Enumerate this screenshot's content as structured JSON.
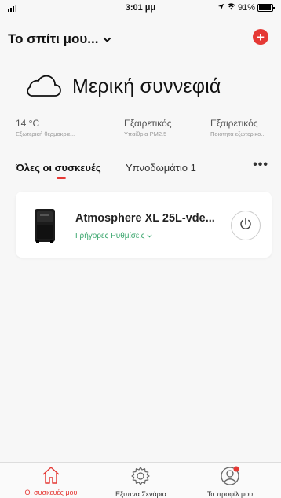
{
  "status_bar": {
    "time": "3:01 μμ",
    "battery": "91%",
    "battery_fraction": 0.91
  },
  "header": {
    "home_name": "Το σπίτι μου...",
    "add_icon": "plus-circle-icon"
  },
  "weather": {
    "icon": "cloud-icon",
    "condition": "Μερική συννεφιά"
  },
  "stats": [
    {
      "value": "14 °C",
      "label": "Εξωτερική θερμοκρα..."
    },
    {
      "value": "Εξαιρετικός",
      "label": "Υπαίθρια PM2.5"
    },
    {
      "value": "Εξαιρετικός",
      "label": "Ποιότητα εξωτερικο..."
    }
  ],
  "tabs": [
    {
      "label": "Όλες οι συσκευές",
      "active": true
    },
    {
      "label": "Υπνοδωμάτιο 1",
      "active": false
    }
  ],
  "more_label": "•••",
  "devices": [
    {
      "name": "Atmosphere XL 25L-vde...",
      "subtitle": "Γρήγορες Ρυθμίσεις",
      "icon": "dehumidifier-icon",
      "power_icon": "power-icon"
    }
  ],
  "tab_bar": [
    {
      "label": "Οι συσκευές μου",
      "icon": "home-icon",
      "active": true
    },
    {
      "label": "Έξυπνα Σενάρια",
      "icon": "gear-icon",
      "active": false
    },
    {
      "label": "Το προφίλ μου",
      "icon": "profile-icon",
      "active": false
    }
  ],
  "colors": {
    "accent": "#e53935",
    "link_green": "#3aa66d",
    "background": "#f7f7f7"
  }
}
